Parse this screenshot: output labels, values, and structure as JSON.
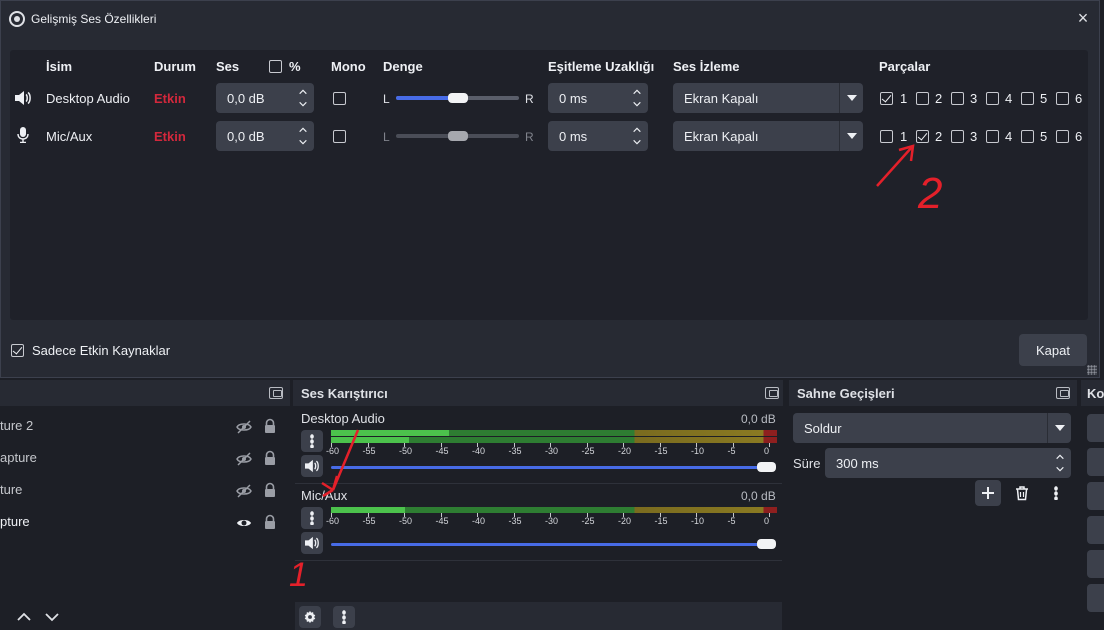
{
  "dialog": {
    "title": "Gelişmiş Ses Özellikleri",
    "headers": {
      "name": "İsim",
      "status": "Durum",
      "volume": "Ses",
      "percent": "%",
      "mono": "Mono",
      "balance": "Denge",
      "sync_offset": "Eşitleme Uzaklığı",
      "monitoring": "Ses İzleme",
      "tracks": "Parçalar"
    },
    "balance_left": "L",
    "balance_right": "R",
    "rows": [
      {
        "icon": "speaker-icon",
        "name": "Desktop Audio",
        "status": "Etkin",
        "volume": "0,0 dB",
        "mono": false,
        "balance": 0.5,
        "sync": "0 ms",
        "monitoring": "Ekran Kapalı",
        "tracks": [
          {
            "label": "1",
            "checked": true
          },
          {
            "label": "2",
            "checked": false
          },
          {
            "label": "3",
            "checked": false
          },
          {
            "label": "4",
            "checked": false
          },
          {
            "label": "5",
            "checked": false
          },
          {
            "label": "6",
            "checked": false
          }
        ]
      },
      {
        "icon": "microphone-icon",
        "name": "Mic/Aux",
        "status": "Etkin",
        "volume": "0,0 dB",
        "mono": false,
        "balance": 0.5,
        "sync": "0 ms",
        "monitoring": "Ekran Kapalı",
        "tracks": [
          {
            "label": "1",
            "checked": false
          },
          {
            "label": "2",
            "checked": true
          },
          {
            "label": "3",
            "checked": false
          },
          {
            "label": "4",
            "checked": false
          },
          {
            "label": "5",
            "checked": false
          },
          {
            "label": "6",
            "checked": false
          }
        ]
      }
    ],
    "only_active_label": "Sadece Etkin Kaynaklar",
    "only_active_checked": true,
    "close_button": "Kapat"
  },
  "sources": {
    "items": [
      {
        "label": "ture 2",
        "visible": false
      },
      {
        "label": "apture",
        "visible": false
      },
      {
        "label": "ture",
        "visible": false
      },
      {
        "label": "pture",
        "visible": true
      }
    ]
  },
  "mixer": {
    "title": "Ses Karıştırıcı",
    "channels": [
      {
        "name": "Desktop Audio",
        "db": "0,0 dB"
      },
      {
        "name": "Mic/Aux",
        "db": "0,0 dB"
      }
    ],
    "scale": [
      "-60",
      "-55",
      "-50",
      "-45",
      "-40",
      "-35",
      "-30",
      "-25",
      "-20",
      "-15",
      "-10",
      "-5",
      "0"
    ]
  },
  "transitions": {
    "title": "Sahne Geçişleri",
    "selected": "Soldur",
    "duration_label": "Süre",
    "duration_value": "300 ms"
  },
  "controls": {
    "title_fragment": "Ko"
  },
  "annotations": {
    "label_1": "1",
    "label_2": "2",
    "color": "#e4202a"
  },
  "colors": {
    "accent": "#476be6",
    "status_active": "#d2283c",
    "meter_green": "#4cc24c",
    "meter_yellow": "#b9a332",
    "meter_red": "#c42b2b"
  }
}
